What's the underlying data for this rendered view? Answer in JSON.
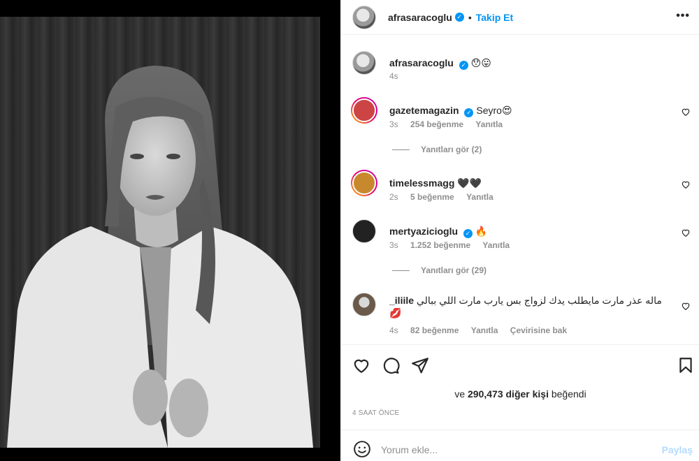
{
  "post": {
    "author": "afrasaracoglu",
    "follow_label": "Takip Et",
    "dot": "•",
    "more_label": "•••"
  },
  "caption": {
    "author": "afrasaracoglu",
    "text": "😯😛",
    "time": "4s"
  },
  "comments": [
    {
      "username": "gazetemagazin",
      "verified": true,
      "text": "Seyro😍",
      "time": "3s",
      "likes": "254 beğenme",
      "reply_label": "Yanıtla",
      "view_replies": "Yanıtları gör (2)"
    },
    {
      "username": "timelessmagg",
      "verified": false,
      "text": "🖤🖤",
      "time": "2s",
      "likes": "5 beğenme",
      "reply_label": "Yanıtla"
    },
    {
      "username": "mertyazicioglu",
      "verified": true,
      "text": "🔥",
      "time": "3s",
      "likes": "1.252 beğenme",
      "reply_label": "Yanıtla",
      "view_replies": "Yanıtları gör (29)"
    },
    {
      "username": "_iliile",
      "verified": false,
      "text": "ماله عذر مارت مايطلب يدك لزواج بس يارب مارت اللي ببالي 💋",
      "time": "4s",
      "likes": "82 beğenme",
      "reply_label": "Yanıtla",
      "translate_label": "Çevirisine bak"
    }
  ],
  "likes_summary": {
    "prefix": "ve",
    "count": "290,473 diğer kişi",
    "suffix": "beğendi"
  },
  "timestamp": "4 SAAT ÖNCE",
  "composer": {
    "placeholder": "Yorum ekle...",
    "post_label": "Paylaş"
  },
  "colors": {
    "accent": "#0095f6",
    "muted": "#8e8e8e",
    "text": "#262626",
    "post_disabled": "#b3dbff"
  }
}
